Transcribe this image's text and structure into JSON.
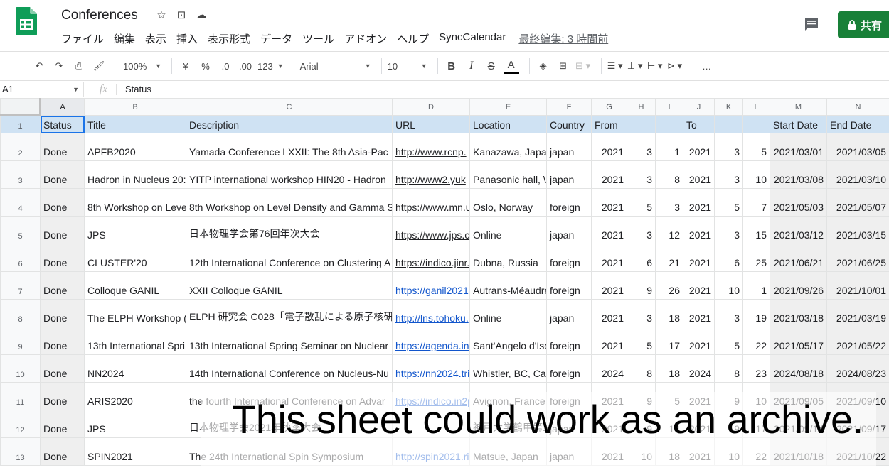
{
  "app": {
    "title": "Conferences",
    "share_label": "共有",
    "last_edit": "最終編集: 3 時間前",
    "colors": {
      "share": "#188038",
      "header_row": "#cfe2f3",
      "link": "#1155cc",
      "selection": "#1a73e8"
    }
  },
  "menu": [
    "ファイル",
    "編集",
    "表示",
    "挿入",
    "表示形式",
    "データ",
    "ツール",
    "アドオン",
    "ヘルプ",
    "SyncCalendar"
  ],
  "toolbar": {
    "zoom": "100%",
    "currency": "¥",
    "percent": "%",
    "dec_decrease": ".0",
    "dec_increase": ".00",
    "format_more": "123",
    "font": "Arial",
    "font_size": "10",
    "bold": "B",
    "italic": "I",
    "strike": "S",
    "text_color": "A",
    "more": "…"
  },
  "formula_bar": {
    "cell": "A1",
    "fx": "fx",
    "value": "Status"
  },
  "columns": [
    "A",
    "B",
    "C",
    "D",
    "E",
    "F",
    "G",
    "H",
    "I",
    "J",
    "K",
    "L",
    "M",
    "N"
  ],
  "header_row": [
    "Status",
    "Title",
    "Description",
    "URL",
    "Location",
    "Country",
    "From",
    "",
    "",
    "To",
    "",
    "",
    "Start Date",
    "End Date"
  ],
  "rows": [
    [
      "Done",
      "APFB2020",
      "Yamada Conference LXXII: The 8th Asia-Pac",
      "http://www.rcnp.",
      "Kanazawa, Japa",
      "japan",
      "2021",
      "3",
      "1",
      "2021",
      "3",
      "5",
      "2021/03/01",
      "2021/03/05"
    ],
    [
      "Done",
      "Hadron in Nucleus 20:",
      "YITP international workshop HIN20 - Hadron",
      "http://www2.yuk",
      "Panasonic hall, \\",
      "japan",
      "2021",
      "3",
      "8",
      "2021",
      "3",
      "10",
      "2021/03/08",
      "2021/03/10"
    ],
    [
      "Done",
      "8th Workshop on Leve",
      "8th Workshop on Level Density and Gamma S",
      "https://www.mn.u",
      "Oslo, Norway",
      "foreign",
      "2021",
      "5",
      "3",
      "2021",
      "5",
      "7",
      "2021/05/03",
      "2021/05/07"
    ],
    [
      "Done",
      "JPS",
      "日本物理学会第76回年次大会",
      "https://www.jps.c",
      "Online",
      "japan",
      "2021",
      "3",
      "12",
      "2021",
      "3",
      "15",
      "2021/03/12",
      "2021/03/15"
    ],
    [
      "Done",
      "CLUSTER'20",
      "12th International Conference on Clustering A",
      "https://indico.jinr.",
      "Dubna, Russia",
      "foreign",
      "2021",
      "6",
      "21",
      "2021",
      "6",
      "25",
      "2021/06/21",
      "2021/06/25"
    ],
    [
      "Done",
      "Colloque GANIL",
      "XXII Colloque GANIL",
      "https://ganil2021",
      "Autrans-Méaudre",
      "foreign",
      "2021",
      "9",
      "26",
      "2021",
      "10",
      "1",
      "2021/09/26",
      "2021/10/01"
    ],
    [
      "Done",
      "The ELPH Workshop (",
      "ELPH 研究会 C028「電子散乱による原子核研",
      "http://lns.tohoku.",
      "Online",
      "japan",
      "2021",
      "3",
      "18",
      "2021",
      "3",
      "19",
      "2021/03/18",
      "2021/03/19"
    ],
    [
      "Done",
      "13th International Spri",
      "13th International Spring Seminar on Nuclear",
      "https://agenda.in",
      "Sant'Angelo d'Isc",
      "foreign",
      "2021",
      "5",
      "17",
      "2021",
      "5",
      "22",
      "2021/05/17",
      "2021/05/22"
    ],
    [
      "Done",
      "NN2024",
      "14th International Conference on Nucleus-Nu",
      "https://nn2024.tri",
      "Whistler, BC, Ca",
      "foreign",
      "2024",
      "8",
      "18",
      "2024",
      "8",
      "23",
      "2024/08/18",
      "2024/08/23"
    ],
    [
      "Done",
      "ARIS2020",
      "the fourth International Conference on Advar",
      "https://indico.in2p",
      "Avignon, France",
      "foreign",
      "2021",
      "9",
      "5",
      "2021",
      "9",
      "10",
      "2021/09/05",
      "2021/09/10"
    ],
    [
      "Done",
      "JPS",
      "日本物理学会2021年秋季大会",
      "",
      "神戸大学鶴甲第1",
      "japan",
      "2021",
      "9",
      "14",
      "2021",
      "9",
      "17",
      "2021/09/14",
      "2021/09/17"
    ],
    [
      "Done",
      "SPIN2021",
      "The 24th International Spin Symposium",
      "http://spin2021.ri",
      "Matsue, Japan",
      "japan",
      "2021",
      "10",
      "18",
      "2021",
      "10",
      "22",
      "2021/10/18",
      "2021/10/22"
    ]
  ],
  "overlay": {
    "text": "This sheet could work as an archive."
  }
}
